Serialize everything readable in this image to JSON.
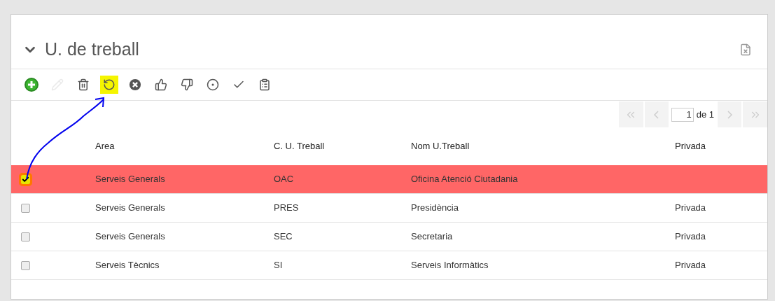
{
  "panel": {
    "title": "U. de treball",
    "expanded": true
  },
  "toolbar": [
    {
      "kind": "add",
      "disabled": false,
      "highlighted": false
    },
    {
      "kind": "edit",
      "disabled": true,
      "highlighted": false
    },
    {
      "kind": "delete",
      "disabled": false,
      "highlighted": false
    },
    {
      "kind": "undo",
      "disabled": false,
      "highlighted": true
    },
    {
      "kind": "cancel",
      "disabled": false,
      "highlighted": false
    },
    {
      "kind": "approve",
      "disabled": false,
      "highlighted": false
    },
    {
      "kind": "reject",
      "disabled": false,
      "highlighted": false
    },
    {
      "kind": "target",
      "disabled": false,
      "highlighted": false
    },
    {
      "kind": "check",
      "disabled": false,
      "highlighted": false
    },
    {
      "kind": "list",
      "disabled": false,
      "highlighted": false
    }
  ],
  "pager": {
    "page": "1",
    "of": "de 1"
  },
  "table": {
    "columns": [
      "Area",
      "C. U. Treball",
      "Nom U.Treball",
      "Privada"
    ],
    "rows": [
      {
        "selected": true,
        "checked": true,
        "cells": [
          "Serveis Generals",
          "OAC",
          "Oficina Atenció Ciutadania",
          ""
        ]
      },
      {
        "selected": false,
        "checked": false,
        "cells": [
          "Serveis Generals",
          "PRES",
          "Presidència",
          "Privada"
        ]
      },
      {
        "selected": false,
        "checked": false,
        "cells": [
          "Serveis Generals",
          "SEC",
          "Secretaria",
          "Privada"
        ]
      },
      {
        "selected": false,
        "checked": false,
        "cells": [
          "Serveis Tècnics",
          "SI",
          "Serveis Informàtics",
          "Privada"
        ]
      }
    ]
  }
}
